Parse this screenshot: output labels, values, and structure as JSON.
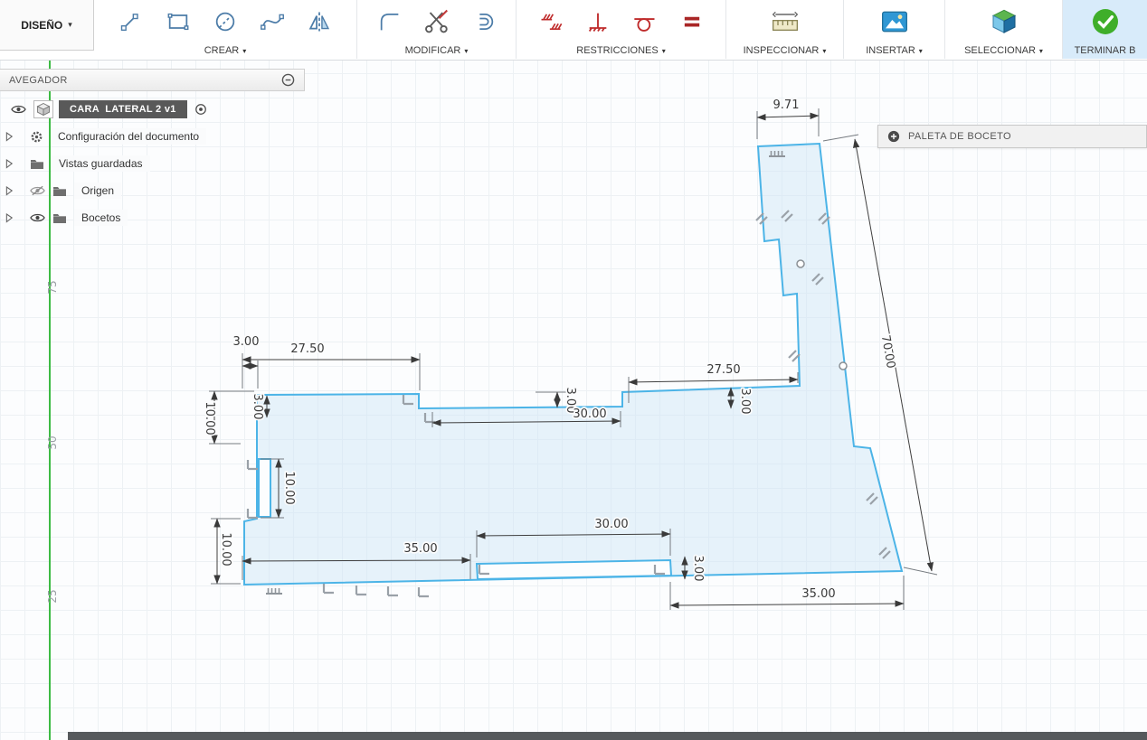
{
  "icons": {
    "caret": "▾"
  },
  "toolbar": {
    "workspace": "DISEÑO",
    "groups": [
      {
        "label": "CREAR"
      },
      {
        "label": "MODIFICAR"
      },
      {
        "label": "RESTRICCIONES"
      },
      {
        "label": "INSPECCIONAR"
      },
      {
        "label": "INSERTAR"
      },
      {
        "label": "SELECCIONAR"
      },
      {
        "label": "TERMINAR B"
      }
    ]
  },
  "navegador": {
    "title": "AVEGADOR",
    "items": [
      {
        "label": "CARA  LATERAL 2 v1"
      },
      {
        "label": "Configuración del documento"
      },
      {
        "label": "Vistas guardadas"
      },
      {
        "label": "Origen"
      },
      {
        "label": "Bocetos"
      }
    ]
  },
  "paleta": {
    "title": "PALETA DE BOCETO"
  },
  "canvas": {
    "axis_labels": [
      "75",
      "50",
      "25"
    ],
    "dimensions": {
      "top_width": "9.71",
      "right_length": "70.00",
      "upper_left_span": "27.50",
      "upper_left_step": "3.00",
      "mid_step": "3.00",
      "mid_span": "30.00",
      "upper_right_span": "27.50",
      "upper_right_step": "3.00",
      "left_upper_height": "10.00",
      "left_step": "3.00",
      "slot_height": "10.00",
      "left_lower_height": "10.00",
      "bottom_left_span": "35.00",
      "bottom_mid_span": "30.00",
      "bottom_slot_height": "3.00",
      "bottom_right_span": "35.00"
    }
  }
}
